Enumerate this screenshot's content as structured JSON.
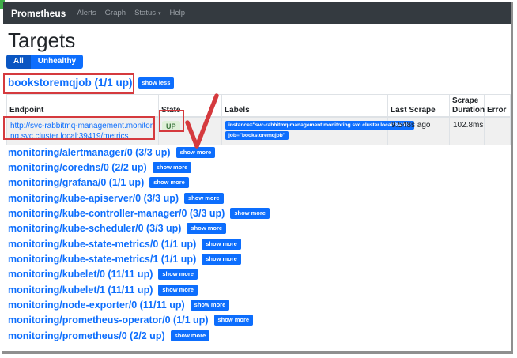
{
  "navbar": {
    "brand": "Prometheus",
    "items": [
      {
        "label": "Alerts"
      },
      {
        "label": "Graph"
      },
      {
        "label": "Status"
      },
      {
        "label": "Help"
      }
    ],
    "caret": "▾"
  },
  "page": {
    "title": "Targets"
  },
  "filters": {
    "all_label": "All",
    "unhealthy_label": "Unhealthy"
  },
  "expanded_job": {
    "title": "bookstoremqjob (1/1 up)",
    "toggle_label": "show less"
  },
  "table": {
    "headers": [
      "Endpoint",
      "State",
      "Labels",
      "Last Scrape",
      "Scrape Duration",
      "Error"
    ],
    "rows": [
      {
        "endpoint": "http://svc-rabbitmq-management.monitoring.svc.cluster.local:39419/metrics",
        "state": "UP",
        "labels": [
          "instance=\"svc-rabbitmq-management.monitoring.svc.cluster.local:39419\"",
          "job=\"bookstoremqjob\""
        ],
        "last_scrape": "9.548s ago",
        "scrape_duration": "102.8ms",
        "error": ""
      }
    ]
  },
  "collapsed_jobs": [
    {
      "title": "monitoring/alertmanager/0 (3/3 up)",
      "toggle_label": "show more"
    },
    {
      "title": "monitoring/coredns/0 (2/2 up)",
      "toggle_label": "show more"
    },
    {
      "title": "monitoring/grafana/0 (1/1 up)",
      "toggle_label": "show more"
    },
    {
      "title": "monitoring/kube-apiserver/0 (3/3 up)",
      "toggle_label": "show more"
    },
    {
      "title": "monitoring/kube-controller-manager/0 (3/3 up)",
      "toggle_label": "show more"
    },
    {
      "title": "monitoring/kube-scheduler/0 (3/3 up)",
      "toggle_label": "show more"
    },
    {
      "title": "monitoring/kube-state-metrics/0 (1/1 up)",
      "toggle_label": "show more"
    },
    {
      "title": "monitoring/kube-state-metrics/1 (1/1 up)",
      "toggle_label": "show more"
    },
    {
      "title": "monitoring/kubelet/0 (11/11 up)",
      "toggle_label": "show more"
    },
    {
      "title": "monitoring/kubelet/1 (11/11 up)",
      "toggle_label": "show more"
    },
    {
      "title": "monitoring/node-exporter/0 (11/11 up)",
      "toggle_label": "show more"
    },
    {
      "title": "monitoring/prometheus-operator/0 (1/1 up)",
      "toggle_label": "show more"
    },
    {
      "title": "monitoring/prometheus/0 (2/2 up)",
      "toggle_label": "show more"
    }
  ],
  "annotations": {
    "color": "#d53a3e",
    "boxes": [
      "expanded-job-heading",
      "endpoint-cell",
      "state-up-badge"
    ],
    "checkmark": "hand-drawn red check over state column"
  },
  "colors": {
    "navbar_bg": "#343a40",
    "accent_blue": "#0d6efd",
    "active_filter_blue": "#0a56c2",
    "row_stripe": "#f0f0f0",
    "up_badge_bg": "#dff0d8",
    "up_badge_text": "#3c763d",
    "annotation_red": "#d53a3e"
  }
}
